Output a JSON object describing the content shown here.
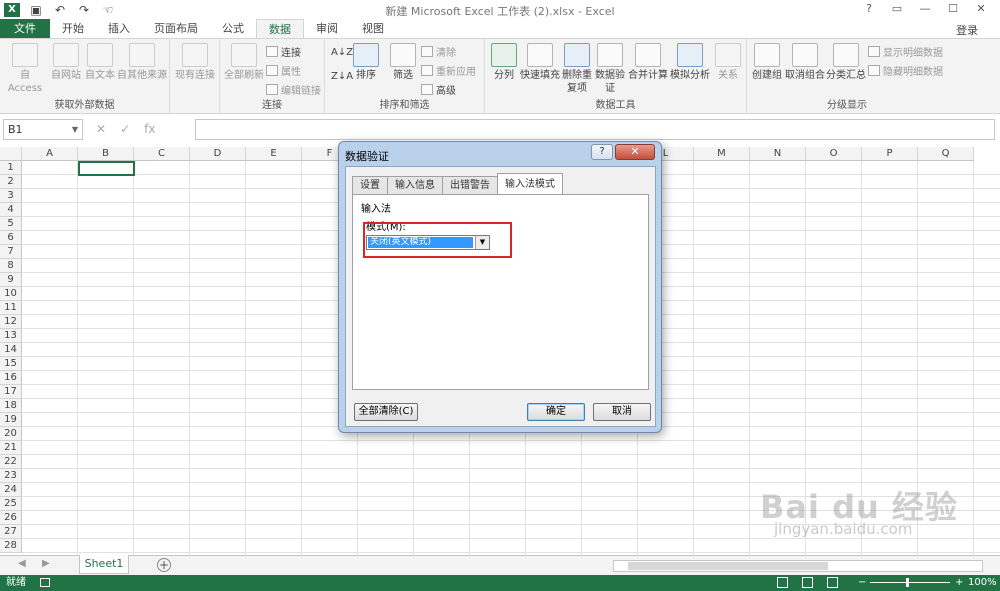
{
  "window": {
    "title": "新建 Microsoft Excel 工作表 (2).xlsx - Excel",
    "login": "登录",
    "logo": "X",
    "controls": [
      "?",
      "▭",
      "—",
      "☐",
      "✕"
    ]
  },
  "tabs": [
    "文件",
    "开始",
    "插入",
    "页面布局",
    "公式",
    "数据",
    "审阅",
    "视图"
  ],
  "active_tab": "数据",
  "ribbon": {
    "get_external": {
      "label": "获取外部数据",
      "buttons": [
        "自 Access",
        "自网站",
        "自文本",
        "自其他来源",
        "现有连接"
      ]
    },
    "connections": {
      "label": "连接",
      "refresh": "全部刷新",
      "items": [
        "连接",
        "属性",
        "编辑链接"
      ]
    },
    "sort_filter": {
      "label": "排序和筛选",
      "sort_az": "A↓Z",
      "sort_za": "Z↓A",
      "sort": "排序",
      "filter": "筛选",
      "items": [
        "清除",
        "重新应用",
        "高级"
      ]
    },
    "data_tools": {
      "label": "数据工具",
      "buttons": [
        "分列",
        "快速填充",
        "删除重复项",
        "数据验证",
        "合并计算",
        "模拟分析",
        "关系"
      ]
    },
    "outline": {
      "label": "分级显示",
      "buttons": [
        "创建组",
        "取消组合",
        "分类汇总"
      ],
      "items": [
        "显示明细数据",
        "隐藏明细数据"
      ]
    }
  },
  "formula_bar": {
    "name_box": "B1",
    "cancel": "✕",
    "enter": "✓",
    "fx": "fx",
    "value": ""
  },
  "columns": [
    "A",
    "B",
    "C",
    "D",
    "E",
    "F",
    "G",
    "H",
    "I",
    "J",
    "K",
    "L",
    "M",
    "N",
    "O",
    "P",
    "Q"
  ],
  "rows": [
    "1",
    "2",
    "3",
    "4",
    "5",
    "6",
    "7",
    "8",
    "9",
    "10",
    "11",
    "12",
    "13",
    "14",
    "15",
    "16",
    "17",
    "18",
    "19",
    "20",
    "21",
    "22",
    "23",
    "24",
    "25",
    "26",
    "27",
    "28"
  ],
  "sheets": [
    "Sheet1"
  ],
  "add_sheet": "+",
  "status": {
    "text": "就绪",
    "zoom": "100%",
    "minus": "−",
    "plus": "+"
  },
  "dialog": {
    "title": "数据验证",
    "help": "?",
    "close": "✕",
    "tabs": [
      "设置",
      "输入信息",
      "出错警告",
      "输入法模式"
    ],
    "active_tab": "输入法模式",
    "section": "输入法",
    "mode_label": "模式(M):",
    "mode_value": "关闭(英文模式)",
    "clear_all": "全部清除(C)",
    "ok": "确定",
    "cancel": "取消"
  },
  "watermark": {
    "text": "Bai du 经验",
    "sub": "jingyan.baidu.com"
  },
  "colors": {
    "excel_green": "#217346",
    "highlight_red": "#d9242a",
    "selection_blue": "#3399ff"
  }
}
